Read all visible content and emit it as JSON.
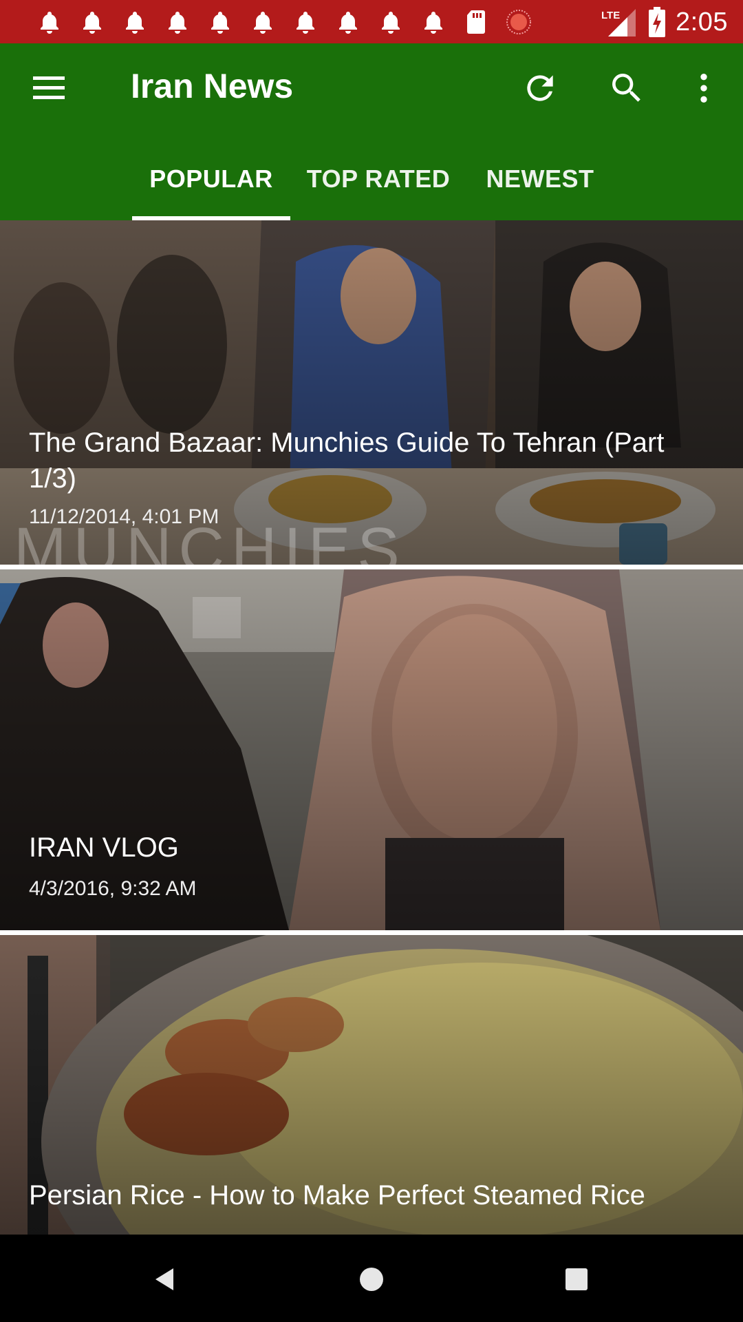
{
  "status_bar": {
    "icons": [
      "bell-icon",
      "bell-icon",
      "bell-icon",
      "bell-icon",
      "bell-icon",
      "bell-icon",
      "bell-icon",
      "bell-icon",
      "bell-icon",
      "bell-icon",
      "sd-card-icon",
      "recording-icon"
    ],
    "network": "LTE",
    "time": "2:05"
  },
  "app_bar": {
    "title": "Iran News",
    "actions": [
      "refresh-icon",
      "search-icon",
      "more-vert-icon"
    ],
    "color": "#1a700a"
  },
  "tabs": [
    {
      "label": "POPULAR",
      "selected": true
    },
    {
      "label": "TOP RATED",
      "selected": false
    },
    {
      "label": "NEWEST",
      "selected": false
    }
  ],
  "feed": [
    {
      "title": "The Grand Bazaar: Munchies Guide To Tehran (Part 1/3)",
      "date": "11/12/2014, 4:01 PM",
      "image_watermark": "MUNCHIES"
    },
    {
      "title": "IRAN VLOG",
      "date": "4/3/2016, 9:32 AM"
    },
    {
      "title": "Persian Rice - How to Make Perfect Steamed Rice",
      "date": ""
    }
  ],
  "nav_bar": {
    "buttons": [
      "back-icon",
      "home-icon",
      "recents-icon"
    ]
  },
  "colors": {
    "status_bar": "#b31b1b",
    "app_bar": "#1a700a"
  }
}
